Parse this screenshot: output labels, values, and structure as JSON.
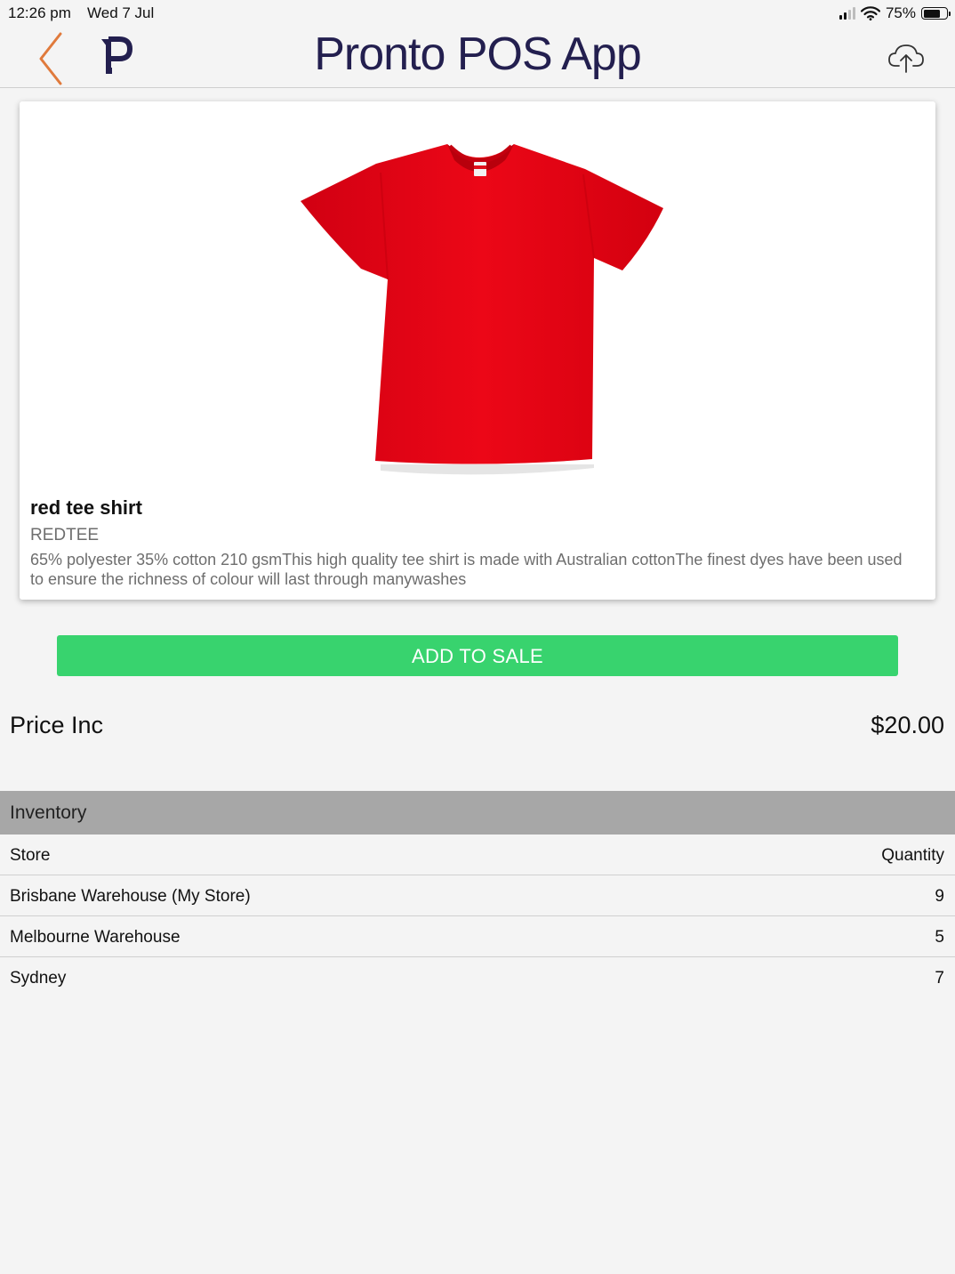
{
  "status_bar": {
    "time": "12:26 pm",
    "date": "Wed 7 Jul",
    "battery": "75%",
    "battery_level": 0.75,
    "icons": [
      "signal-icon",
      "wifi-icon",
      "battery-icon"
    ]
  },
  "header": {
    "title": "Pronto POS App",
    "logo_letter": "P",
    "back_icon": "chevron-left-icon",
    "cloud_icon": "cloud-upload-icon",
    "colors": {
      "title": "#231f4f",
      "back": "#e07a3c"
    }
  },
  "product": {
    "image": "red-tee-shirt-image",
    "name": "red tee shirt",
    "code": "REDTEE",
    "description": "65% polyester 35% cotton 210 gsmThis high quality tee shirt is made with Australian cottonThe finest dyes have been used to ensure the richness of colour will last through manywashes"
  },
  "actions": {
    "add_to_sale": "ADD TO SALE",
    "add_to_sale_color": "#38d36e"
  },
  "price": {
    "label": "Price Inc",
    "value": "$20.00"
  },
  "inventory": {
    "title": "Inventory",
    "columns": [
      "Store",
      "Quantity"
    ],
    "rows": [
      {
        "store": "Brisbane Warehouse (My Store)",
        "quantity": "9"
      },
      {
        "store": "Melbourne Warehouse",
        "quantity": "5"
      },
      {
        "store": "Sydney",
        "quantity": "7"
      }
    ]
  }
}
